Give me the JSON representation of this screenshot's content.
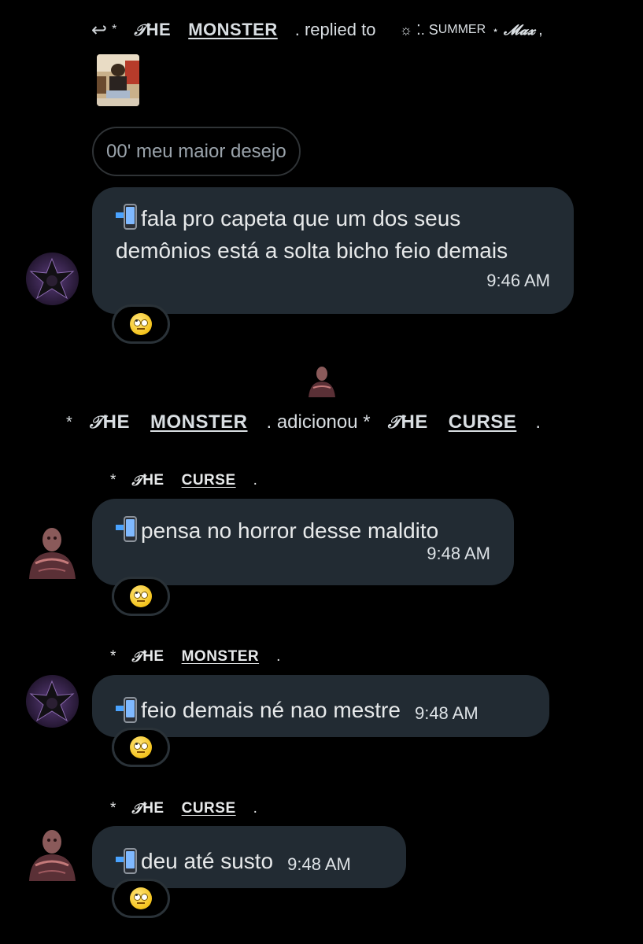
{
  "reply": {
    "star": "*",
    "author_script": "𝒯",
    "author_he": "HE",
    "author_name": "MONSTER",
    "replied_text": ". replied to",
    "target_prefix": "☼ ⁚. S",
    "target_name": "UMMER",
    "target_star": "⋆",
    "target_script": "𝓜𝓪𝔁",
    "target_suffix": ","
  },
  "quote": {
    "text": "00' meu maior desejo"
  },
  "messages": [
    {
      "text": "fala pro capeta que um dos seus demônios está a solta bicho feio demais",
      "time": "9:46 AM",
      "reaction": "🙄"
    },
    {
      "sender_star": "*",
      "sender_script": "𝒯",
      "sender_he": "HE",
      "sender_name": "CURSE",
      "sender_dot": ".",
      "text": "pensa no horror desse maldito",
      "time": "9:48 AM",
      "reaction": "🙄"
    },
    {
      "sender_star": "*",
      "sender_script": "𝒯",
      "sender_he": "HE",
      "sender_name": "MONSTER",
      "sender_dot": ".",
      "text": "feio demais né nao mestre",
      "time": "9:48 AM",
      "reaction": "🙄"
    },
    {
      "sender_star": "*",
      "sender_script": "𝒯",
      "sender_he": "HE",
      "sender_name": "CURSE",
      "sender_dot": ".",
      "text": "deu até susto",
      "time": "9:48 AM",
      "reaction": "🙄"
    }
  ],
  "system": {
    "star1": "*",
    "actor_script": "𝒯",
    "actor_he": "HE",
    "actor_name": "MONSTER",
    "action": ". adicionou *",
    "target_script": "𝒯",
    "target_he": "HE",
    "target_name": "CURSE",
    "dot": "."
  },
  "icons": {
    "reply": "reply-arrow-icon",
    "phone": "mobile-phone-arrow-icon",
    "reaction": "face-with-rolling-eyes-icon"
  },
  "colors": {
    "background": "#000000",
    "bubble": "#222b33",
    "text": "#e7e9ea"
  }
}
